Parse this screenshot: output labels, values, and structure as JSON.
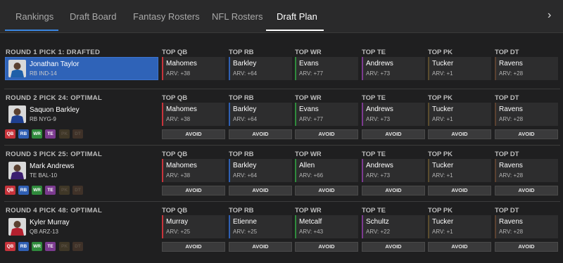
{
  "nav": {
    "tabs": [
      {
        "label": "Rankings"
      },
      {
        "label": "Draft Board"
      },
      {
        "label": "Fantasy Rosters"
      },
      {
        "label": "NFL Rosters"
      },
      {
        "label": "Draft Plan"
      }
    ],
    "active_tab": "Draft Plan",
    "next_arrow": "›"
  },
  "colors": {
    "accent_blue": "#3a86e0",
    "drafted_blue": "#2f63b8",
    "QB": "#c7333b",
    "RB": "#2f5fb3",
    "WR": "#2f8a3c",
    "TE": "#7b3a8f",
    "PK": "#5a4c2e",
    "DT": "#5a4030"
  },
  "column_headers": [
    "TOP QB",
    "TOP RB",
    "TOP WR",
    "TOP TE",
    "TOP PK",
    "TOP DT"
  ],
  "position_badges": [
    "QB",
    "RB",
    "WR",
    "TE",
    "PK",
    "DT"
  ],
  "avoid_label": "AVOID",
  "rounds": [
    {
      "title": "ROUND 1 PICK 1: DRAFTED",
      "drafted": true,
      "player": {
        "name": "Jonathan Taylor",
        "team": "RB IND-14"
      },
      "badges_active": [],
      "picks": [
        {
          "pos": "QB",
          "name": "Mahomes",
          "arv": "ARV: +38"
        },
        {
          "pos": "RB",
          "name": "Barkley",
          "arv": "ARV: +64"
        },
        {
          "pos": "WR",
          "name": "Evans",
          "arv": "ARV: +77"
        },
        {
          "pos": "TE",
          "name": "Andrews",
          "arv": "ARV: +73"
        },
        {
          "pos": "PK",
          "name": "Tucker",
          "arv": "ARV: +1"
        },
        {
          "pos": "DT",
          "name": "Ravens",
          "arv": "ARV: +28"
        }
      ]
    },
    {
      "title": "ROUND 2 PICK 24: OPTIMAL",
      "drafted": false,
      "player": {
        "name": "Saquon Barkley",
        "team": "RB NYG-9"
      },
      "badges_active": [
        "QB",
        "RB",
        "WR",
        "TE"
      ],
      "picks": [
        {
          "pos": "QB",
          "name": "Mahomes",
          "arv": "ARV: +38"
        },
        {
          "pos": "RB",
          "name": "Barkley",
          "arv": "ARV: +64"
        },
        {
          "pos": "WR",
          "name": "Evans",
          "arv": "ARV: +77"
        },
        {
          "pos": "TE",
          "name": "Andrews",
          "arv": "ARV: +73"
        },
        {
          "pos": "PK",
          "name": "Tucker",
          "arv": "ARV: +1"
        },
        {
          "pos": "DT",
          "name": "Ravens",
          "arv": "ARV: +28"
        }
      ]
    },
    {
      "title": "ROUND 3 PICK 25: OPTIMAL",
      "drafted": false,
      "player": {
        "name": "Mark Andrews",
        "team": "TE BAL-10"
      },
      "badges_active": [
        "QB",
        "RB",
        "WR",
        "TE"
      ],
      "picks": [
        {
          "pos": "QB",
          "name": "Mahomes",
          "arv": "ARV: +38"
        },
        {
          "pos": "RB",
          "name": "Barkley",
          "arv": "ARV: +64"
        },
        {
          "pos": "WR",
          "name": "Allen",
          "arv": "ARV: +66"
        },
        {
          "pos": "TE",
          "name": "Andrews",
          "arv": "ARV: +73"
        },
        {
          "pos": "PK",
          "name": "Tucker",
          "arv": "ARV: +1"
        },
        {
          "pos": "DT",
          "name": "Ravens",
          "arv": "ARV: +28"
        }
      ]
    },
    {
      "title": "ROUND 4 PICK 48: OPTIMAL",
      "drafted": false,
      "player": {
        "name": "Kyler Murray",
        "team": "QB ARZ-13"
      },
      "badges_active": [
        "QB",
        "RB",
        "WR",
        "TE"
      ],
      "picks": [
        {
          "pos": "QB",
          "name": "Murray",
          "arv": "ARV: +25"
        },
        {
          "pos": "RB",
          "name": "Etienne",
          "arv": "ARV: +25"
        },
        {
          "pos": "WR",
          "name": "Metcalf",
          "arv": "ARV: +43"
        },
        {
          "pos": "TE",
          "name": "Schultz",
          "arv": "ARV: +22"
        },
        {
          "pos": "PK",
          "name": "Tucker",
          "arv": "ARV: +1"
        },
        {
          "pos": "DT",
          "name": "Ravens",
          "arv": "ARV: +28"
        }
      ]
    }
  ]
}
